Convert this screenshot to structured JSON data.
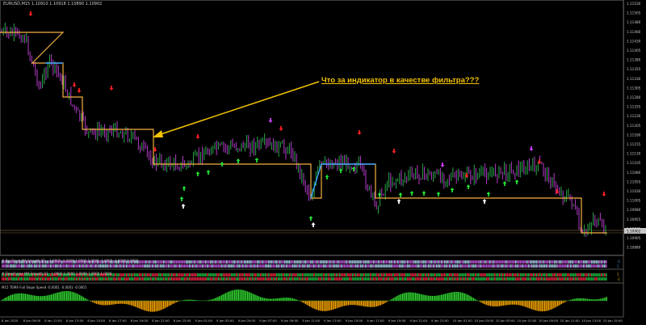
{
  "symbol_line": "EURUSD,M15  1.10910 1.10918 1.10890 1.10902",
  "annotation_text": "Что за индикатор в качестве фильтра???",
  "current_price": "1.10902",
  "price_axis_labels": [
    "1.11530",
    "1.11505",
    "1.11480",
    "1.11460",
    "1.11430",
    "1.11405",
    "1.11380",
    "1.11355",
    "1.11330",
    "1.11305",
    "1.11280",
    "1.11255",
    "1.11230",
    "1.11205",
    "1.11180",
    "1.11155",
    "1.11130",
    "1.11105",
    "1.11080",
    "1.11055",
    "1.11030",
    "1.11005",
    "1.10980",
    "1.10955",
    "1.10930",
    "1.10905",
    "1.10880"
  ],
  "time_axis_labels": [
    "8 Jan 2020",
    "8 Jan 09:00",
    "8 Jan 11:00",
    "8 Jan 13:00",
    "8 Jan 15:00",
    "8 Jan 17:00",
    "8 Jan 19:00",
    "8 Jan 21:00",
    "8 Jan 23:00",
    "9 Jan 01:00",
    "9 Jan 03:00",
    "9 Jan 05:00",
    "9 Jan 07:00",
    "9 Jan 09:00",
    "9 Jan 11:00",
    "9 Jan 13:00",
    "9 Jan 15:00",
    "9 Jan 17:00",
    "9 Jan 19:00",
    "9 Jan 21:00",
    "9 Jan 23:00",
    "10 Jan 01:00",
    "10 Jan 03:00",
    "10 Jan 05:00",
    "10 Jan 07:00",
    "10 Jan 09:00",
    "10 Jan 11:00",
    "10 Jan 13:00",
    "10 Jan 15:00"
  ],
  "subwindows": [
    {
      "title": "# Big Ravel MA Smooth 05 - -1.0000 -1.0000 1.0000 1.0000 -1.0000 -1.0000 1.0000",
      "palette": [
        "#b04ec8",
        "#9bb9d6",
        "#b04ec8",
        "#9bb9d6"
      ],
      "side_values": [
        "-1",
        "1"
      ]
    },
    {
      "title": "# TimeFrame MA Smooth 03 - 1.0000 1.0000 1.0000 1.0000 1.0000",
      "palette": [
        "#1ca83a",
        "#d0223c",
        "#1ca83a",
        "#d0223c"
      ],
      "side_values": [
        "1",
        "-1"
      ]
    },
    {
      "title": "M15 TEMA Full Slope Speed -0.0001 -0.0001 -0.0001",
      "palette": [
        "#2dcc2d",
        "#f0a000"
      ],
      "side_values": []
    }
  ],
  "colors": {
    "bull_candle": "#2aa84a",
    "bear_candle": "#b33bc8",
    "filter_line": "#f5b041",
    "filter_line_active": "#3aa0ff",
    "annotation": "#f5c400",
    "up_arrow": "#22e035",
    "down_arrow": "#ff2020",
    "magenta_arrow": "#d040ff"
  }
}
